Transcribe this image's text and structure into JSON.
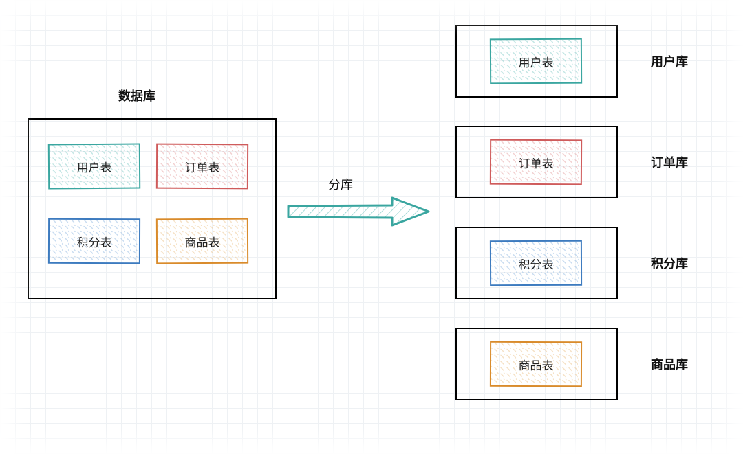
{
  "source_db": {
    "title": "数据库",
    "tables": {
      "user": {
        "label": "用户表",
        "color": "teal"
      },
      "order": {
        "label": "订单表",
        "color": "red"
      },
      "points": {
        "label": "积分表",
        "color": "blue"
      },
      "product": {
        "label": "商品表",
        "color": "orange"
      }
    }
  },
  "action": {
    "label": "分库"
  },
  "target_dbs": [
    {
      "db_label": "用户库",
      "table_label": "用户表",
      "color": "teal"
    },
    {
      "db_label": "订单库",
      "table_label": "订单表",
      "color": "red"
    },
    {
      "db_label": "积分库",
      "table_label": "积分表",
      "color": "blue"
    },
    {
      "db_label": "商品库",
      "table_label": "商品表",
      "color": "orange"
    }
  ],
  "colors": {
    "teal": "#3aa6a0",
    "red": "#cf5b5b",
    "blue": "#3d7bbf",
    "orange": "#d98b2b"
  }
}
